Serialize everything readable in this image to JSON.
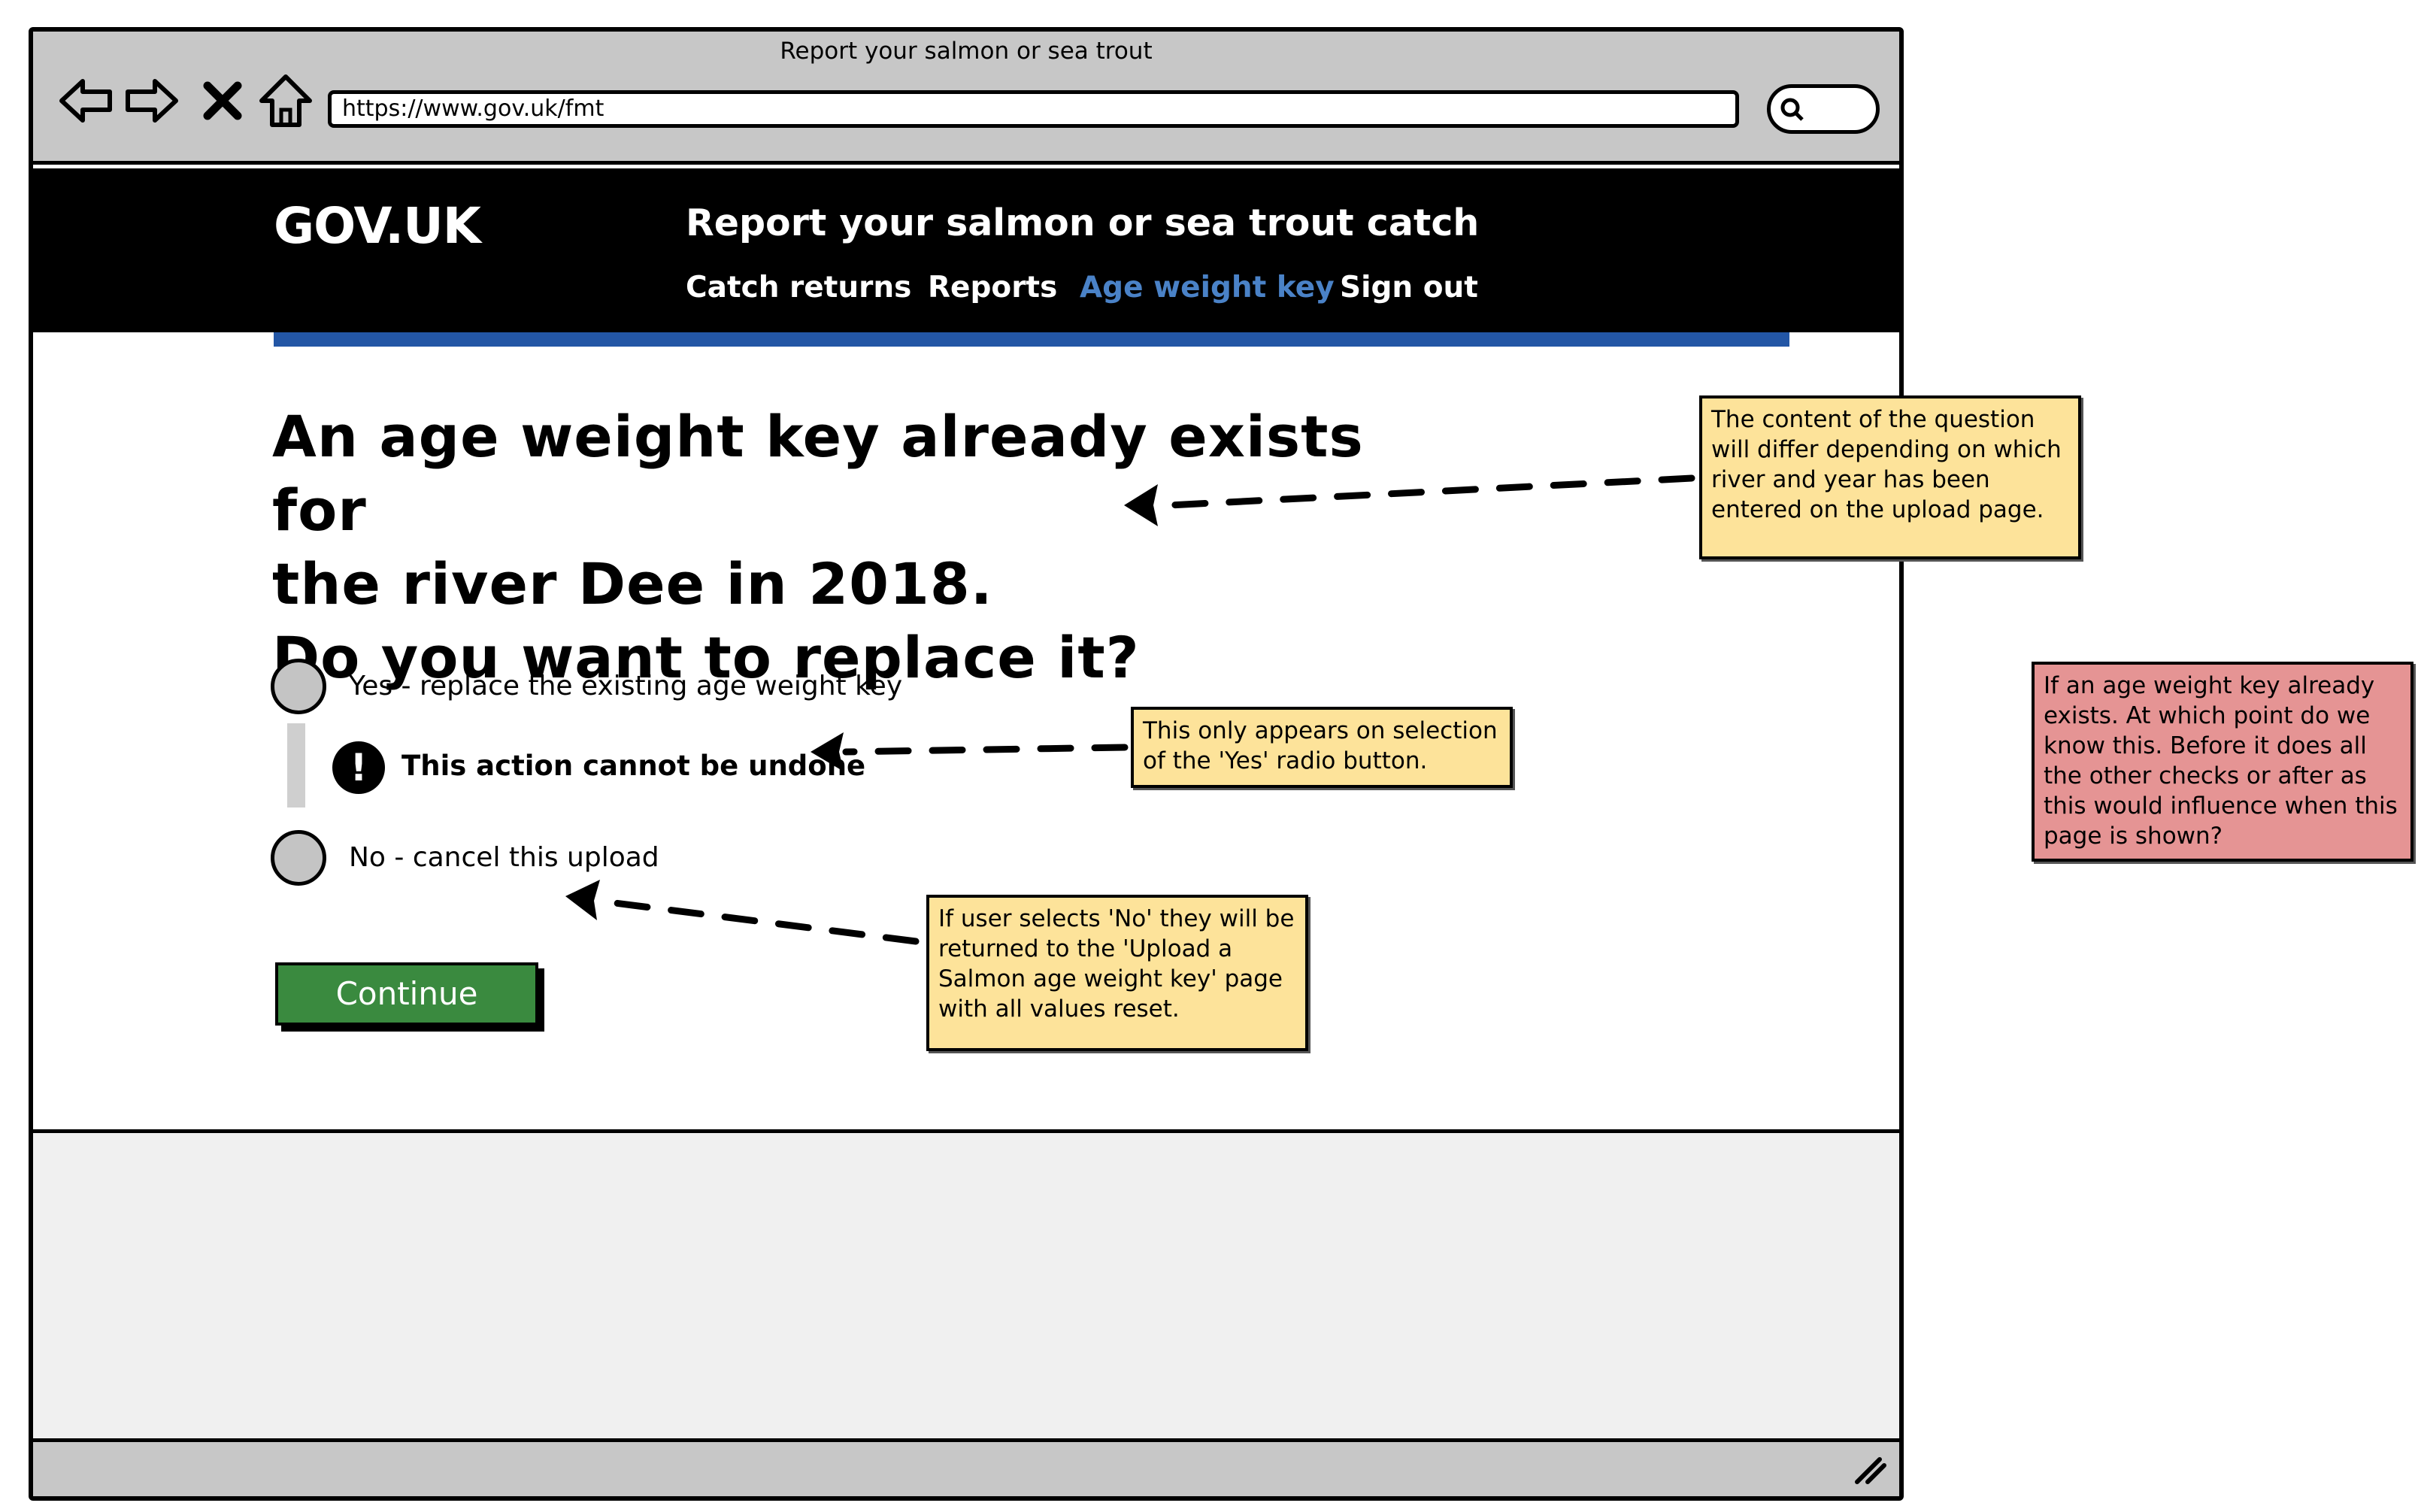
{
  "browser": {
    "title": "Report your salmon or sea trout",
    "url": "https://www.gov.uk/fmt",
    "icons": [
      "back-arrow-icon",
      "forward-arrow-icon",
      "close-x-icon",
      "home-icon",
      "search-icon",
      "resize-grip-icon"
    ]
  },
  "header": {
    "logo": "GOV.UK",
    "service_name": "Report your salmon or sea trout catch",
    "nav": [
      {
        "label": "Catch returns",
        "active": false
      },
      {
        "label": "Reports",
        "active": false
      },
      {
        "label": "Age weight key",
        "active": true
      },
      {
        "label": "Sign out",
        "active": false
      }
    ]
  },
  "main": {
    "heading_lines": [
      "An age weight key already exists for",
      "the river Dee in 2018.",
      "Do you want to replace it?"
    ],
    "options": [
      {
        "label": "Yes - replace the existing age weight key",
        "selected": false
      },
      {
        "label": "No - cancel this upload",
        "selected": false
      }
    ],
    "warning": {
      "icon": "exclamation-icon",
      "text": "This action cannot be undone"
    },
    "continue_label": "Continue"
  },
  "notes": {
    "question": "The content of the question will differ depending on which river and year has been entered on the upload page.",
    "yes_only": "This only appears on selection of the 'Yes' radio button.",
    "no_return": "If user selects 'No' they will be returned to the 'Upload a Salmon age weight key' page with all values reset.",
    "timing": "If an age weight key already exists. At which point do we know this. Before it does all the other checks or after as this would influence when this page is shown?"
  },
  "colors": {
    "header_bg": "#000000",
    "active_nav": "#4a82c7",
    "blue_rule": "#2356a5",
    "button_green": "#3a8a3f",
    "note_yellow": "#fde39a",
    "note_red": "#e59494"
  }
}
